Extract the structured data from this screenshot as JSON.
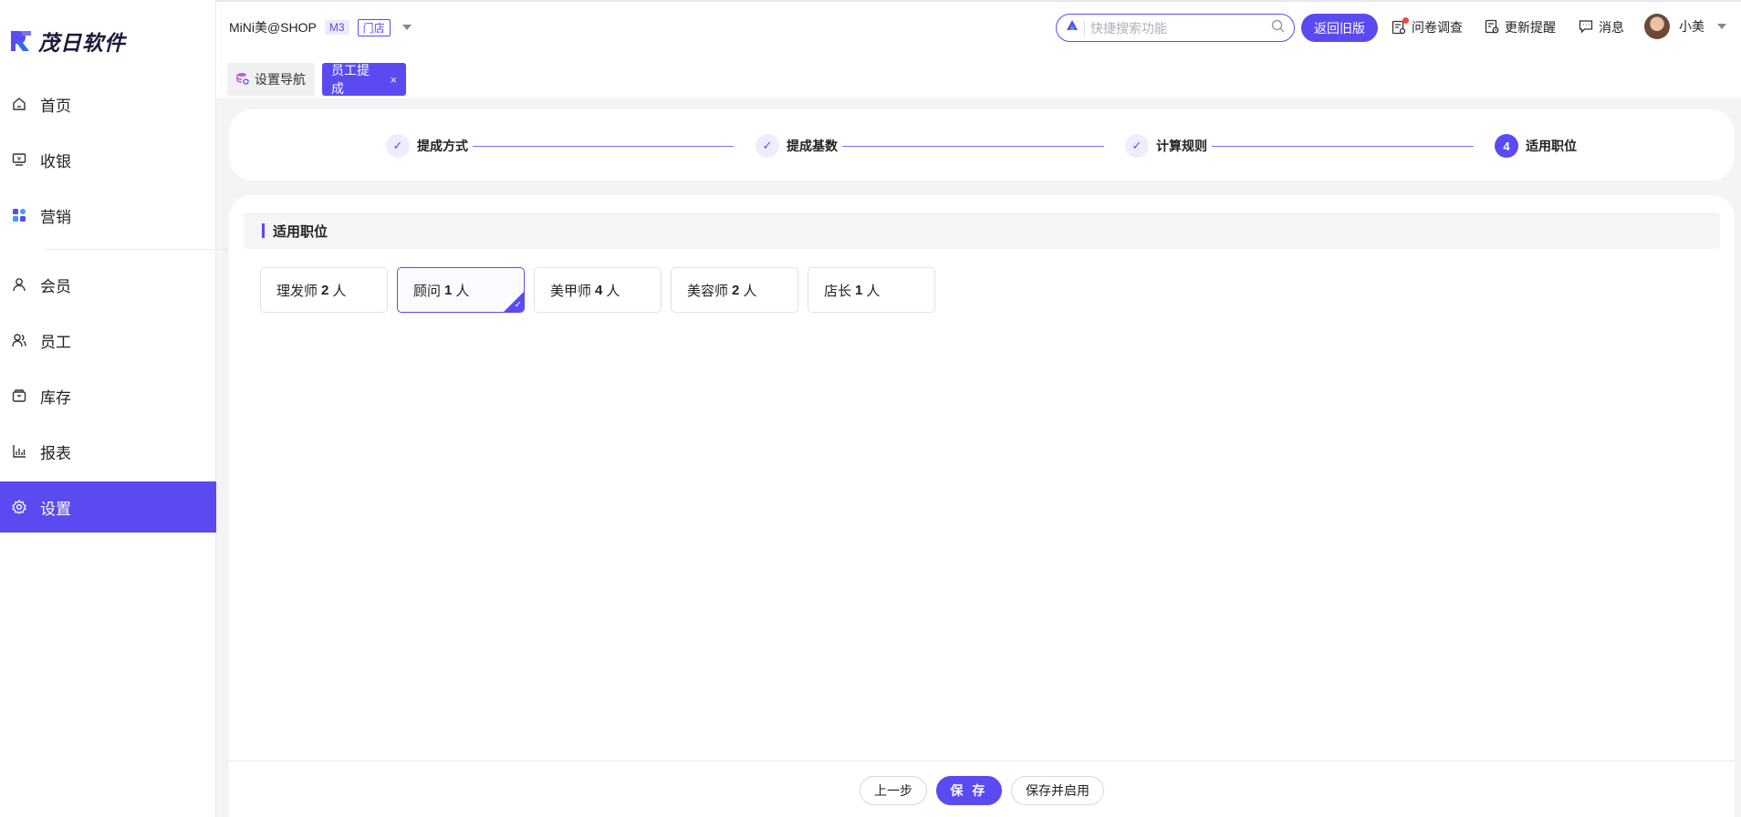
{
  "app": {
    "logo_text": "茂日软件"
  },
  "sidebar": {
    "items": [
      {
        "label": "首页",
        "icon": "home-icon"
      },
      {
        "label": "收银",
        "icon": "cashier-icon"
      },
      {
        "label": "营销",
        "icon": "marketing-icon"
      },
      {
        "label": "会员",
        "icon": "member-icon"
      },
      {
        "label": "员工",
        "icon": "staff-icon"
      },
      {
        "label": "库存",
        "icon": "inventory-icon"
      },
      {
        "label": "报表",
        "icon": "report-icon"
      },
      {
        "label": "设置",
        "icon": "settings-icon",
        "active": true
      }
    ]
  },
  "header": {
    "shop_name": "MiNi美@SHOP",
    "badge_m3": "M3",
    "badge_store": "门店",
    "search_placeholder": "快捷搜索功能",
    "back_old_label": "返回旧版",
    "survey_label": "问卷调查",
    "update_label": "更新提醒",
    "message_label": "消息",
    "user_name": "小美"
  },
  "tabs": [
    {
      "label": "设置导航",
      "active": false
    },
    {
      "label": "员工提成",
      "active": true,
      "close": "×"
    }
  ],
  "steps": [
    {
      "label": "提成方式",
      "status": "done",
      "mark": "✓"
    },
    {
      "label": "提成基数",
      "status": "done",
      "mark": "✓"
    },
    {
      "label": "计算规则",
      "status": "done",
      "mark": "✓"
    },
    {
      "label": "适用职位",
      "status": "current",
      "mark": "4"
    }
  ],
  "section": {
    "title": "适用职位"
  },
  "positions": [
    {
      "name": "理发师",
      "count": "2",
      "unit": "人",
      "selected": false
    },
    {
      "name": "顾问",
      "count": "1",
      "unit": "人",
      "selected": true
    },
    {
      "name": "美甲师",
      "count": "4",
      "unit": "人",
      "selected": false
    },
    {
      "name": "美容师",
      "count": "2",
      "unit": "人",
      "selected": false
    },
    {
      "name": "店长",
      "count": "1",
      "unit": "人",
      "selected": false
    }
  ],
  "footer": {
    "prev_label": "上一步",
    "save_label": "保 存",
    "save_enable_label": "保存并启用"
  },
  "colors": {
    "accent": "#5b4af0",
    "background": "#f4f4f6"
  }
}
